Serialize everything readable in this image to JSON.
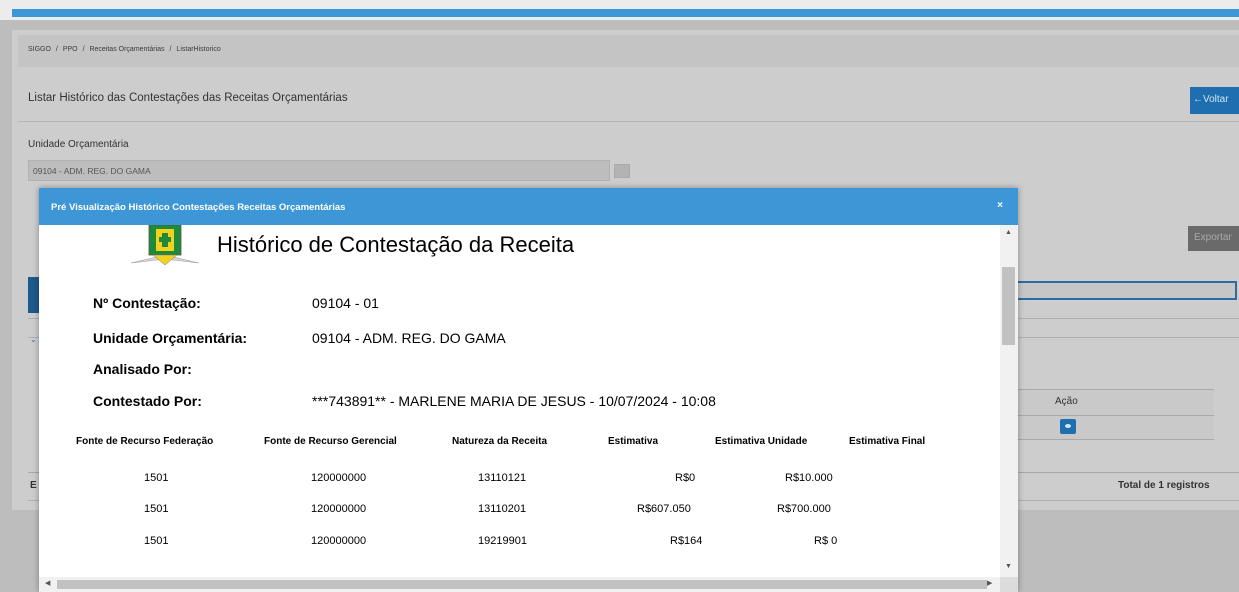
{
  "breadcrumb": [
    "SIGGO",
    "PPO",
    "Receitas Orçamentárias",
    "ListarHistorico"
  ],
  "breadcrumb_separator": "/",
  "page": {
    "title": "Listar Histórico das Contestações das Receitas Orçamentárias",
    "back_label": "Voltar",
    "unidade_label": "Unidade Orçamentária",
    "unidade_value": "09104 - ADM. REG. DO GAMA",
    "export_label": "Exportar",
    "grid_action_header": "Ação",
    "grid_first_letter": "E",
    "total_text": "Total de 1 registros"
  },
  "modal": {
    "title": "Pré Visualização Histórico Contestações Receitas Orçamentárias",
    "close_glyph": "×",
    "document": {
      "heading": "Histórico de Contestação da Receita",
      "fields": [
        {
          "label": "Nº Contestação:",
          "value": "09104 - 01"
        },
        {
          "label": "Unidade Orçamentária:",
          "value": "09104 - ADM. REG. DO GAMA"
        },
        {
          "label": "Analisado Por:",
          "value": ""
        },
        {
          "label": "Contestado Por:",
          "value": "***743891** - MARLENE MARIA DE JESUS - 10/07/2024 - 10:08"
        }
      ],
      "table": {
        "headers": [
          "Fonte de Recurso Federação",
          "Fonte de Recurso Gerencial",
          "Natureza da Receita",
          "Estimativa",
          "Estimativa Unidade",
          "Estimativa Final"
        ],
        "rows": [
          [
            "1501",
            "120000000",
            "13110121",
            "R$0",
            "R$10.000",
            ""
          ],
          [
            "1501",
            "120000000",
            "13110201",
            "R$607.050",
            "R$700.000",
            ""
          ],
          [
            "1501",
            "120000000",
            "19219901",
            "R$164",
            "R$ 0",
            ""
          ]
        ]
      }
    }
  },
  "colors": {
    "accent_blue": "#3d97d6",
    "button_blue": "#1f6fb0",
    "overlay_gray": "#bdbdbd"
  },
  "icons": {
    "back": "arrow-left-icon",
    "close": "close-icon",
    "view": "eye-icon",
    "logo": "brasilia-emblem-logo"
  }
}
